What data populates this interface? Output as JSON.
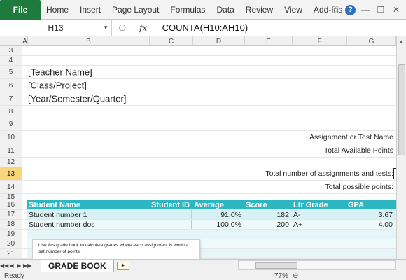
{
  "ribbon": {
    "file_label": "File",
    "tabs": [
      "Home",
      "Insert",
      "Page Layout",
      "Formulas",
      "Data",
      "Review",
      "View",
      "Add-Ins"
    ],
    "icons": [
      "chevron-down-icon",
      "help-icon",
      "minimize-icon",
      "restore-icon",
      "close-icon"
    ]
  },
  "formula_bar": {
    "cell_ref": "H13",
    "fx": "fx",
    "formula": "=COUNTA(H10:AH10)"
  },
  "columns": [
    "A",
    "B",
    "C",
    "D",
    "E",
    "F",
    "G"
  ],
  "row_numbers": [
    "3",
    "4",
    "5",
    "6",
    "7",
    "8",
    "9",
    "10",
    "11",
    "12",
    "13",
    "14",
    "15",
    "16",
    "17",
    "18",
    "19",
    "20",
    "21"
  ],
  "header_block": {
    "teacher": "[Teacher Name]",
    "class": "[Class/Project]",
    "period": "[Year/Semester/Quarter]"
  },
  "labels": {
    "assignment_name": "Assignment or Test Name",
    "total_points": "Total Available Points",
    "total_assignments": "Total number of assignments and tests:",
    "total_possible": "Total possible points:"
  },
  "grade_table": {
    "headers": [
      "Student Name",
      "Student ID",
      "Average",
      "Score",
      "Ltr Grade",
      "GPA"
    ],
    "rows": [
      {
        "name": "Student number 1",
        "id": "",
        "average": "91.0%",
        "score": "182",
        "letter": "A-",
        "gpa": "3.67"
      },
      {
        "name": "Student number dos",
        "id": "",
        "average": "100.0%",
        "score": "200",
        "letter": "A+",
        "gpa": "4.00"
      }
    ]
  },
  "note_text": "Use this grade book to calculate grades where each assignment is worth a set number of points.",
  "sheet_tabs": [
    "GRADE BOOK"
  ],
  "status": {
    "ready": "Ready",
    "zoom": "77%"
  }
}
